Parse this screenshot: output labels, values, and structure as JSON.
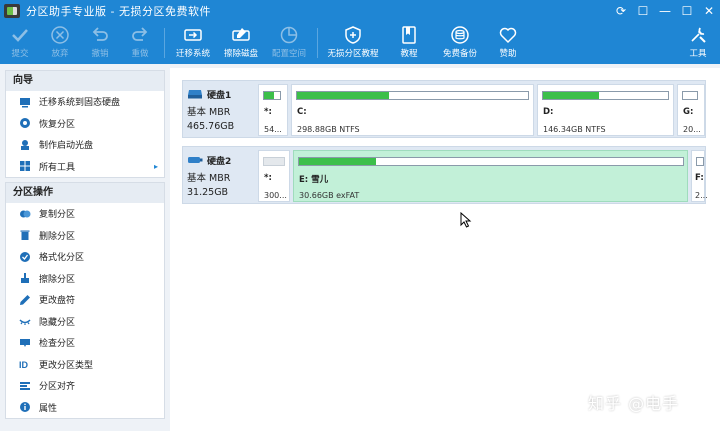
{
  "window": {
    "title": "分区助手专业版 - 无损分区免费软件",
    "controls": [
      "⟳",
      "☐",
      "—",
      "☐",
      "✕"
    ]
  },
  "toolbar": {
    "buttons": [
      {
        "label": "提交",
        "icon": "check-icon",
        "enabled": false
      },
      {
        "label": "放弃",
        "icon": "cancel-icon",
        "enabled": false
      },
      {
        "label": "撤销",
        "icon": "undo-icon",
        "enabled": false
      },
      {
        "label": "重做",
        "icon": "redo-icon",
        "enabled": false
      },
      {
        "label": "迁移系统",
        "icon": "migrate-icon",
        "enabled": true
      },
      {
        "label": "擦除磁盘",
        "icon": "wipe-disk-icon",
        "enabled": true
      },
      {
        "label": "配置空间",
        "icon": "allocate-space-icon",
        "enabled": false
      },
      {
        "label": "无损分区教程",
        "icon": "tutorial-plus-icon",
        "enabled": true
      },
      {
        "label": "教程",
        "icon": "book-icon",
        "enabled": true
      },
      {
        "label": "免费备份",
        "icon": "backup-icon",
        "enabled": true
      },
      {
        "label": "赞助",
        "icon": "heart-icon",
        "enabled": true
      },
      {
        "label": "工具",
        "icon": "tools-icon",
        "enabled": true
      }
    ]
  },
  "sidebar": {
    "wizard": {
      "title": "向导",
      "items": [
        {
          "label": "迁移系统到固态硬盘",
          "icon": "migrate-ssd-icon"
        },
        {
          "label": "恢复分区",
          "icon": "recover-icon"
        },
        {
          "label": "制作启动光盘",
          "icon": "boot-disc-icon"
        },
        {
          "label": "所有工具",
          "icon": "all-tools-icon",
          "arrow": "▸"
        }
      ]
    },
    "ops": {
      "title": "分区操作",
      "items": [
        {
          "label": "复制分区",
          "icon": "copy-icon"
        },
        {
          "label": "删除分区",
          "icon": "delete-icon"
        },
        {
          "label": "格式化分区",
          "icon": "format-icon"
        },
        {
          "label": "擦除分区",
          "icon": "wipe-icon"
        },
        {
          "label": "更改盘符",
          "icon": "pencil-icon"
        },
        {
          "label": "隐藏分区",
          "icon": "hide-icon"
        },
        {
          "label": "检查分区",
          "icon": "check-partition-icon"
        },
        {
          "label": "更改分区类型",
          "icon": "id-icon"
        },
        {
          "label": "分区对齐",
          "icon": "align-icon"
        },
        {
          "label": "属性",
          "icon": "info-icon"
        }
      ]
    }
  },
  "disks": [
    {
      "name": "硬盘1",
      "type": "基本 MBR",
      "size": "465.76GB",
      "partitions": [
        {
          "label": "*:",
          "info": "54...",
          "used": 0.6,
          "selected": false
        },
        {
          "label": "C:",
          "info": "298.88GB NTFS",
          "used": 0.4,
          "selected": false
        },
        {
          "label": "D:",
          "info": "146.34GB NTFS",
          "used": 0.45,
          "selected": false
        },
        {
          "label": "G:",
          "info": "20...",
          "used": 0.0,
          "selected": false
        }
      ]
    },
    {
      "name": "硬盘2",
      "type": "基本 MBR",
      "size": "31.25GB",
      "partitions": [
        {
          "label": "*:",
          "info": "300...",
          "used": 0.0,
          "selected": false
        },
        {
          "label": "E: 雪儿",
          "info": "30.66GB exFAT",
          "used": 0.2,
          "selected": true
        },
        {
          "label": "F:",
          "info": "2...",
          "used": 0.0,
          "selected": false
        }
      ]
    }
  ],
  "watermark": "知乎 @电手",
  "colors": {
    "accent": "#1f86d4",
    "used_fill": "#3cbf4a",
    "selected_partition": "#c2f0d8"
  }
}
